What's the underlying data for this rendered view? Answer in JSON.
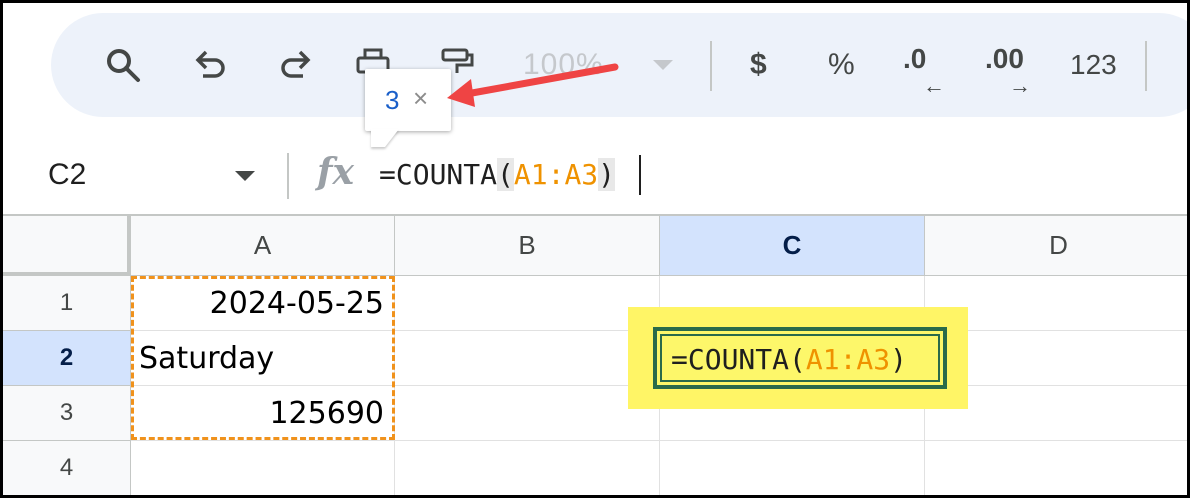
{
  "toolbar": {
    "zoom": "100%",
    "currency": "$",
    "percent": "%",
    "decrease_decimal": ".0",
    "increase_decimal": ".00",
    "number_format": "123"
  },
  "tooltip": {
    "value": "3",
    "close": "×"
  },
  "formula_bar": {
    "name_box": "C2",
    "fx": "fx",
    "formula_prefix": "=COUNTA",
    "open_paren": "(",
    "range_ref": "A1:A3",
    "close_paren": ")"
  },
  "columns": [
    "A",
    "B",
    "C",
    "D"
  ],
  "rows": [
    "1",
    "2",
    "3",
    "4"
  ],
  "cells": {
    "A1": "2024-05-25",
    "A2": "Saturday",
    "A3": "125690"
  },
  "editor": {
    "prefix": "=COUNTA(",
    "range_ref": "A1:A3",
    "suffix": ")"
  },
  "colors": {
    "range_highlight": "#ef9200",
    "annotation_arrow": "#ef4444",
    "annotation_highlight": "#fff566",
    "active_cell_border": "#2a6a4a"
  }
}
